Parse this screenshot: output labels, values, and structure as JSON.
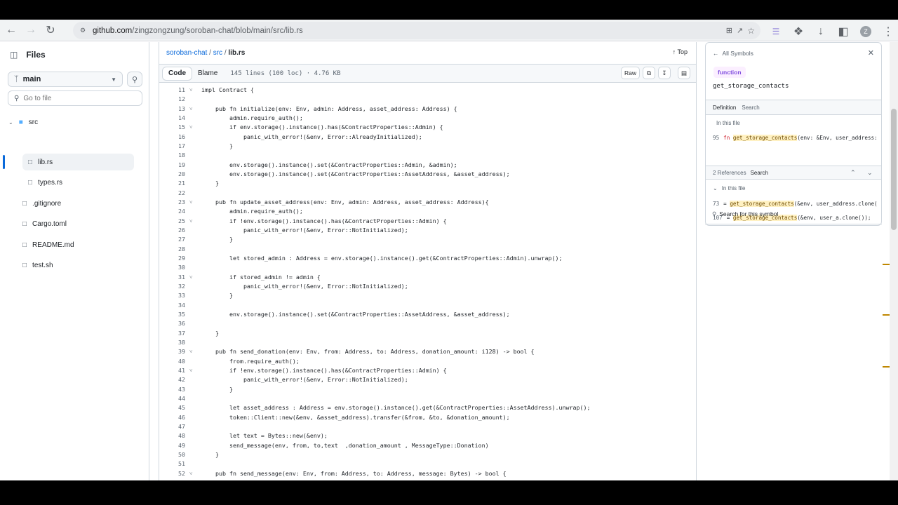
{
  "browser": {
    "url_host": "github.com",
    "url_path": "/zingzongzung/soroban-chat/blob/main/src/lib.rs",
    "avatar_letter": "Z"
  },
  "files_panel": {
    "title": "Files",
    "branch": "main",
    "goto_placeholder": "Go to file",
    "tree": [
      {
        "label": "src",
        "type": "folder"
      },
      {
        "label": "lib.rs",
        "type": "file",
        "selected": true
      },
      {
        "label": "types.rs",
        "type": "file"
      },
      {
        "label": ".gitignore",
        "type": "file"
      },
      {
        "label": "Cargo.toml",
        "type": "file"
      },
      {
        "label": "README.md",
        "type": "file"
      },
      {
        "label": "test.sh",
        "type": "file"
      }
    ]
  },
  "breadcrumb": {
    "repo": "soroban-chat",
    "dir": "src",
    "file": "lib.rs",
    "top_label": "Top"
  },
  "code_toolbar": {
    "code_tab": "Code",
    "blame_tab": "Blame",
    "meta": "145 lines (100 loc) · 4.76 KB",
    "raw_label": "Raw"
  },
  "code_lines": [
    {
      "n": "11",
      "fold": true,
      "text": "impl Contract {"
    },
    {
      "n": "12",
      "fold": false,
      "text": ""
    },
    {
      "n": "13",
      "fold": true,
      "text": "    pub fn initialize(env: Env, admin: Address, asset_address: Address) {"
    },
    {
      "n": "14",
      "fold": false,
      "text": "        admin.require_auth();"
    },
    {
      "n": "15",
      "fold": true,
      "text": "        if env.storage().instance().has(&ContractProperties::Admin) {"
    },
    {
      "n": "16",
      "fold": false,
      "text": "            panic_with_error!(&env, Error::AlreadyInitialized);"
    },
    {
      "n": "17",
      "fold": false,
      "text": "        }"
    },
    {
      "n": "18",
      "fold": false,
      "text": ""
    },
    {
      "n": "19",
      "fold": false,
      "text": "        env.storage().instance().set(&ContractProperties::Admin, &admin);"
    },
    {
      "n": "20",
      "fold": false,
      "text": "        env.storage().instance().set(&ContractProperties::AssetAddress, &asset_address);"
    },
    {
      "n": "21",
      "fold": false,
      "text": "    }"
    },
    {
      "n": "22",
      "fold": false,
      "text": ""
    },
    {
      "n": "23",
      "fold": true,
      "text": "    pub fn update_asset_address(env: Env, admin: Address, asset_address: Address){"
    },
    {
      "n": "24",
      "fold": false,
      "text": "        admin.require_auth();"
    },
    {
      "n": "25",
      "fold": true,
      "text": "        if !env.storage().instance().has(&ContractProperties::Admin) {"
    },
    {
      "n": "26",
      "fold": false,
      "text": "            panic_with_error!(&env, Error::NotInitialized);"
    },
    {
      "n": "27",
      "fold": false,
      "text": "        }"
    },
    {
      "n": "28",
      "fold": false,
      "text": ""
    },
    {
      "n": "29",
      "fold": false,
      "text": "        let stored_admin : Address = env.storage().instance().get(&ContractProperties::Admin).unwrap();"
    },
    {
      "n": "30",
      "fold": false,
      "text": ""
    },
    {
      "n": "31",
      "fold": true,
      "text": "        if stored_admin != admin {"
    },
    {
      "n": "32",
      "fold": false,
      "text": "            panic_with_error!(&env, Error::NotInitialized);"
    },
    {
      "n": "33",
      "fold": false,
      "text": "        }"
    },
    {
      "n": "34",
      "fold": false,
      "text": ""
    },
    {
      "n": "35",
      "fold": false,
      "text": "        env.storage().instance().set(&ContractProperties::AssetAddress, &asset_address);"
    },
    {
      "n": "36",
      "fold": false,
      "text": ""
    },
    {
      "n": "37",
      "fold": false,
      "text": "    }"
    },
    {
      "n": "38",
      "fold": false,
      "text": ""
    },
    {
      "n": "39",
      "fold": true,
      "text": "    pub fn send_donation(env: Env, from: Address, to: Address, donation_amount: i128) -> bool {"
    },
    {
      "n": "40",
      "fold": false,
      "text": "        from.require_auth();"
    },
    {
      "n": "41",
      "fold": true,
      "text": "        if !env.storage().instance().has(&ContractProperties::Admin) {"
    },
    {
      "n": "42",
      "fold": false,
      "text": "            panic_with_error!(&env, Error::NotInitialized);"
    },
    {
      "n": "43",
      "fold": false,
      "text": "        }"
    },
    {
      "n": "44",
      "fold": false,
      "text": ""
    },
    {
      "n": "45",
      "fold": false,
      "text": "        let asset_address : Address = env.storage().instance().get(&ContractProperties::AssetAddress).unwrap();"
    },
    {
      "n": "46",
      "fold": false,
      "text": "        token::Client::new(&env, &asset_address).transfer(&from, &to, &donation_amount);"
    },
    {
      "n": "47",
      "fold": false,
      "text": ""
    },
    {
      "n": "48",
      "fold": false,
      "text": "        let text = Bytes::new(&env);"
    },
    {
      "n": "49",
      "fold": false,
      "text": "        send_message(env, from, to,text  ,donation_amount , MessageType::Donation)"
    },
    {
      "n": "50",
      "fold": false,
      "text": "    }"
    },
    {
      "n": "51",
      "fold": false,
      "text": ""
    },
    {
      "n": "52",
      "fold": true,
      "text": "    pub fn send_message(env: Env, from: Address, to: Address, message: Bytes) -> bool {"
    }
  ],
  "symbols_panel": {
    "back_label": "All Symbols",
    "kind_badge": "function",
    "symbol_name": "get_storage_contacts",
    "tab_definition": "Definition",
    "tab_search": "Search",
    "in_this_file": "In this file",
    "definition_line_no": "95",
    "definition_prefix": "fn ",
    "definition_symbol": "get_storage_contacts",
    "definition_rest": "(env: &Env, user_address:",
    "refs_label": "2 References",
    "refs_search": "Search",
    "refs_in_this_file": "In this file",
    "refs": [
      {
        "n": "73",
        "prefix": "= ",
        "symbol": "get_storage_contacts",
        "rest": "(&env, user_address.clone("
      },
      {
        "n": "107",
        "prefix": "= ",
        "symbol": "get_storage_contacts",
        "rest": "(&env, user_a.clone());"
      }
    ],
    "search_symbol_label": "Search for this symbol"
  }
}
